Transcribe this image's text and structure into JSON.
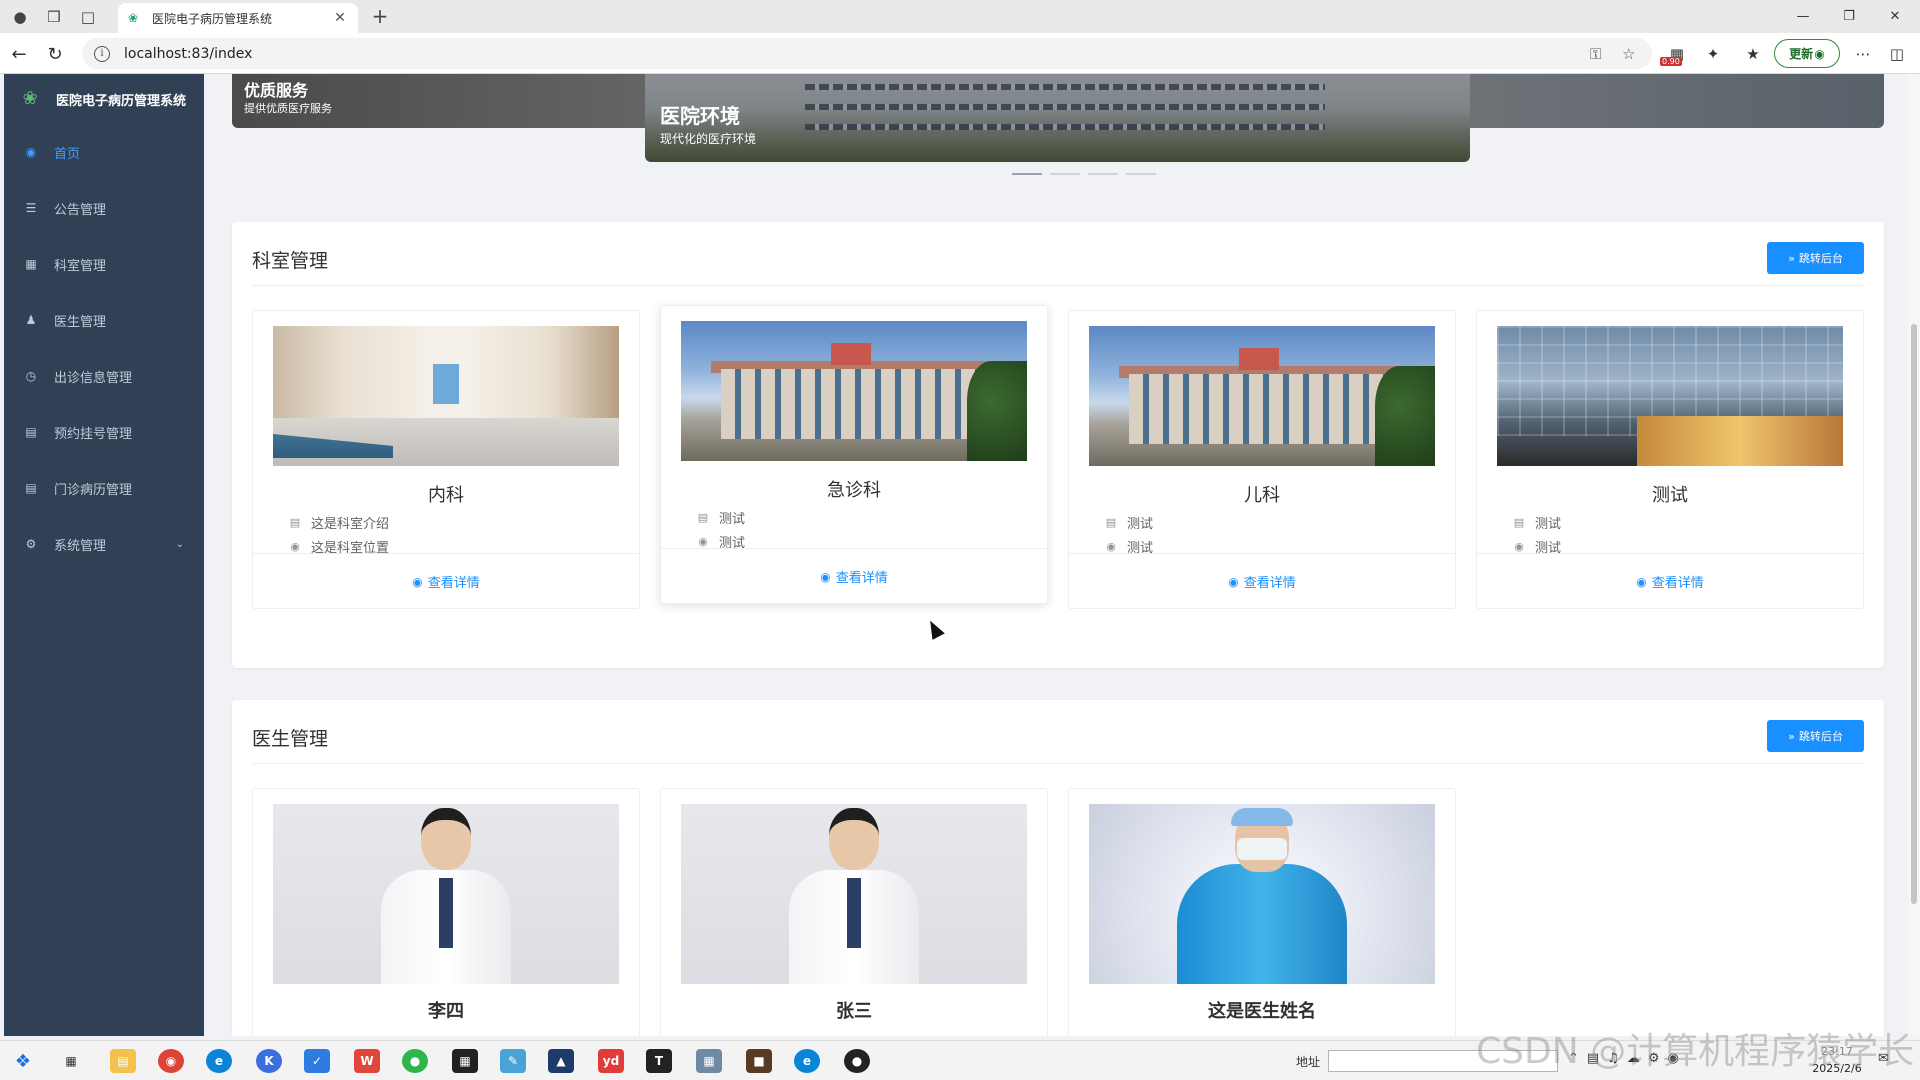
{
  "browser": {
    "tab_title": "医院电子病历管理系统",
    "url": "localhost:83/index",
    "update_label": "更新",
    "ext_badge": "0.90"
  },
  "app": {
    "brand": "医院电子病历管理系统",
    "menu": [
      {
        "label": "首页",
        "icon": "dashboard-icon",
        "active": true
      },
      {
        "label": "公告管理",
        "icon": "list-icon"
      },
      {
        "label": "科室管理",
        "icon": "grid-icon"
      },
      {
        "label": "医生管理",
        "icon": "user-icon"
      },
      {
        "label": "出诊信息管理",
        "icon": "clock-icon"
      },
      {
        "label": "预约挂号管理",
        "icon": "document-icon"
      },
      {
        "label": "门诊病历管理",
        "icon": "document-icon"
      },
      {
        "label": "系统管理",
        "icon": "gear-icon",
        "has_submenu": true
      }
    ]
  },
  "carousel": {
    "left_title": "优质服务",
    "left_sub": "提供优质医疗服务",
    "main_title": "医院环境",
    "main_sub": "现代化的医疗环境",
    "active_dot": 0
  },
  "departments": {
    "title": "科室管理",
    "jump_label": "跳转后台",
    "detail_label": "查看详情",
    "items": [
      {
        "name": "内科",
        "intro": "这是科室介绍",
        "location": "这是科室位置"
      },
      {
        "name": "急诊科",
        "intro": "测试",
        "location": "测试"
      },
      {
        "name": "儿科",
        "intro": "测试",
        "location": "测试"
      },
      {
        "name": "测试",
        "intro": "测试",
        "location": "测试"
      }
    ]
  },
  "doctors": {
    "title": "医生管理",
    "jump_label": "跳转后台",
    "items": [
      {
        "name": "李四"
      },
      {
        "name": "张三"
      },
      {
        "name": "这是医生姓名"
      }
    ]
  },
  "taskbar": {
    "address_label": "地址",
    "date": "2025/2/6",
    "time": "23:17"
  },
  "watermark": "CSDN @计算机程序猿学长"
}
